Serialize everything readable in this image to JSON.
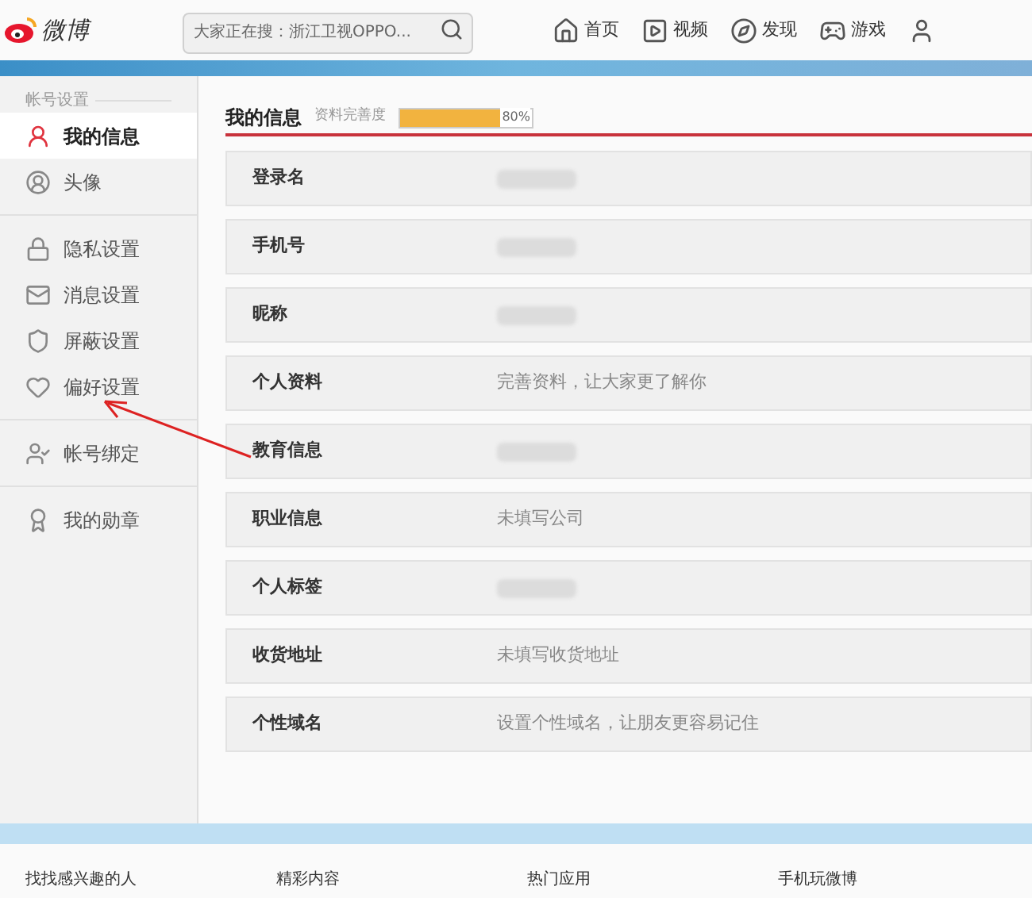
{
  "header": {
    "logo_text": "微博",
    "search": {
      "placeholder": "大家正在搜：浙江卫视OPPO..."
    },
    "nav": [
      {
        "label": "首页"
      },
      {
        "label": "视频"
      },
      {
        "label": "发现"
      },
      {
        "label": "游戏"
      }
    ]
  },
  "sidebar": {
    "section_title": "帐号设置",
    "groups": [
      {
        "items": [
          {
            "label": "我的信息",
            "selected": true
          },
          {
            "label": "头像",
            "selected": false
          }
        ]
      },
      {
        "items": [
          {
            "label": "隐私设置",
            "selected": false
          },
          {
            "label": "消息设置",
            "selected": false
          },
          {
            "label": "屏蔽设置",
            "selected": false
          },
          {
            "label": "偏好设置",
            "selected": false
          }
        ]
      },
      {
        "items": [
          {
            "label": "帐号绑定",
            "selected": false
          }
        ]
      },
      {
        "items": [
          {
            "label": "我的勋章",
            "selected": false
          }
        ]
      }
    ]
  },
  "main": {
    "title": "我的信息",
    "completeness": {
      "label": "资料完善度",
      "level": 0.8,
      "reading": "80%"
    },
    "rows": [
      {
        "label": "登录名",
        "kind": "redacted"
      },
      {
        "label": "手机号",
        "kind": "redacted"
      },
      {
        "label": "昵称",
        "kind": "redacted"
      },
      {
        "label": "个人资料",
        "kind": "text",
        "value": "完善资料，让大家更了解你"
      },
      {
        "label": "教育信息",
        "kind": "redacted"
      },
      {
        "label": "职业信息",
        "kind": "text",
        "value": "未填写公司"
      },
      {
        "label": "个人标签",
        "kind": "redacted"
      },
      {
        "label": "收货地址",
        "kind": "text",
        "value": "未填写收货地址"
      },
      {
        "label": "个性域名",
        "kind": "text",
        "value": "设置个性域名，让朋友更容易记住"
      }
    ]
  },
  "footer": {
    "links": [
      {
        "label": "找找感兴趣的人"
      },
      {
        "label": "精彩内容"
      },
      {
        "label": "热门应用"
      },
      {
        "label": "手机玩微博"
      }
    ]
  }
}
